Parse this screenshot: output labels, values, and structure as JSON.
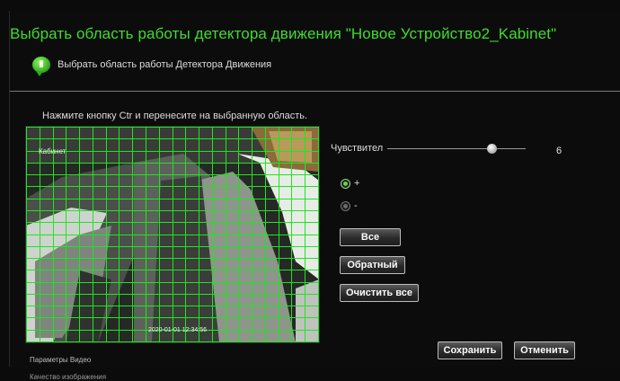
{
  "dialog": {
    "title": "Выбрать область работы детектора движения \"Новое Устройство2_Kabinet\"",
    "subtitle": "Выбрать область работы Детектора Движения",
    "hint": "Нажмите кнопку Ctr и перенесите на выбранную область."
  },
  "video": {
    "overlay_top_left": "Кабинет",
    "overlay_timestamp": "2020-01-01 12:34:56"
  },
  "sensitivity": {
    "label": "Чувствител",
    "value": "6",
    "level_fraction": 0.75
  },
  "radios": [
    {
      "label": "+",
      "selected": true
    },
    {
      "label": "-",
      "selected": false
    }
  ],
  "buttons": {
    "all": "Все",
    "invert": "Обратный",
    "clear_all": "Очистить все",
    "save": "Сохранить",
    "cancel": "Отменить"
  },
  "footer": {
    "video_params": "Параметры Видео",
    "next_item": "Качество изображения"
  },
  "colors": {
    "title_green": "#3fdc2d",
    "grid_green": "#1ee61e"
  }
}
